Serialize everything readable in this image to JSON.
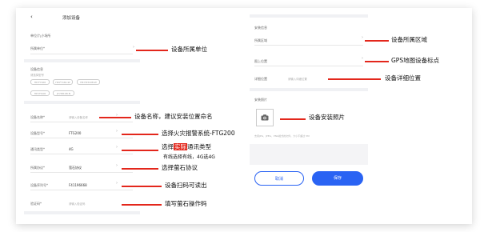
{
  "header": {
    "back": "‹",
    "title": "添加设备"
  },
  "left": {
    "unit_label": "单位/九小场所",
    "owner_unit": "所属单位*",
    "device_info": "设备信息",
    "device_type_label": "请选择型号",
    "chips": [
      "HP-FY100",
      "HP-FY161-W",
      "HP-YD3108-W",
      "HP-YH100",
      "JT-HR108-N"
    ],
    "device_name": "设备名称*",
    "device_name_ph": "请输入设备名称",
    "device_model": "设备型号*",
    "device_model_val": "FTG200",
    "comm_type": "通讯类型*",
    "comm_type_val": "4G",
    "protocol": "所属协议*",
    "protocol_val": "萤石协议",
    "serial": "设备序列号*",
    "serial_val": "F41196668",
    "verify_code": "验证码*",
    "verify_code_ph": "请输入验证码"
  },
  "right": {
    "install_info": "安装信息",
    "area": "所属区域",
    "location": "图上位置",
    "detail_location": "详细位置",
    "detail_location_ph": "请输入详细位置",
    "photo": "安装照片",
    "photo_hint": "支持JPG、JPEG、PNG格式的文件，大小不超过 5M",
    "cancel": "取消",
    "save": "保存"
  },
  "annotations": {
    "owner_unit": "设备所属单位",
    "device_name": "设备名称，建议安装位置命名",
    "device_model": "选择火灾报警系统-FTG200",
    "comm_pre": "选择",
    "comm_hl": "实际",
    "comm_post": "通讯类型",
    "comm_sub": "有线选择有线，4G选4G",
    "protocol": "选择萤石协议",
    "serial": "设备扫码可读出",
    "verify": "填写萤石操作码",
    "area": "设备所属区域",
    "location": "GPS地图设备标点",
    "detail": "设备详细位置",
    "photo": "设备安装照片"
  },
  "colors": {
    "accent": "#2a63f3",
    "annotation": "#e3271c"
  }
}
